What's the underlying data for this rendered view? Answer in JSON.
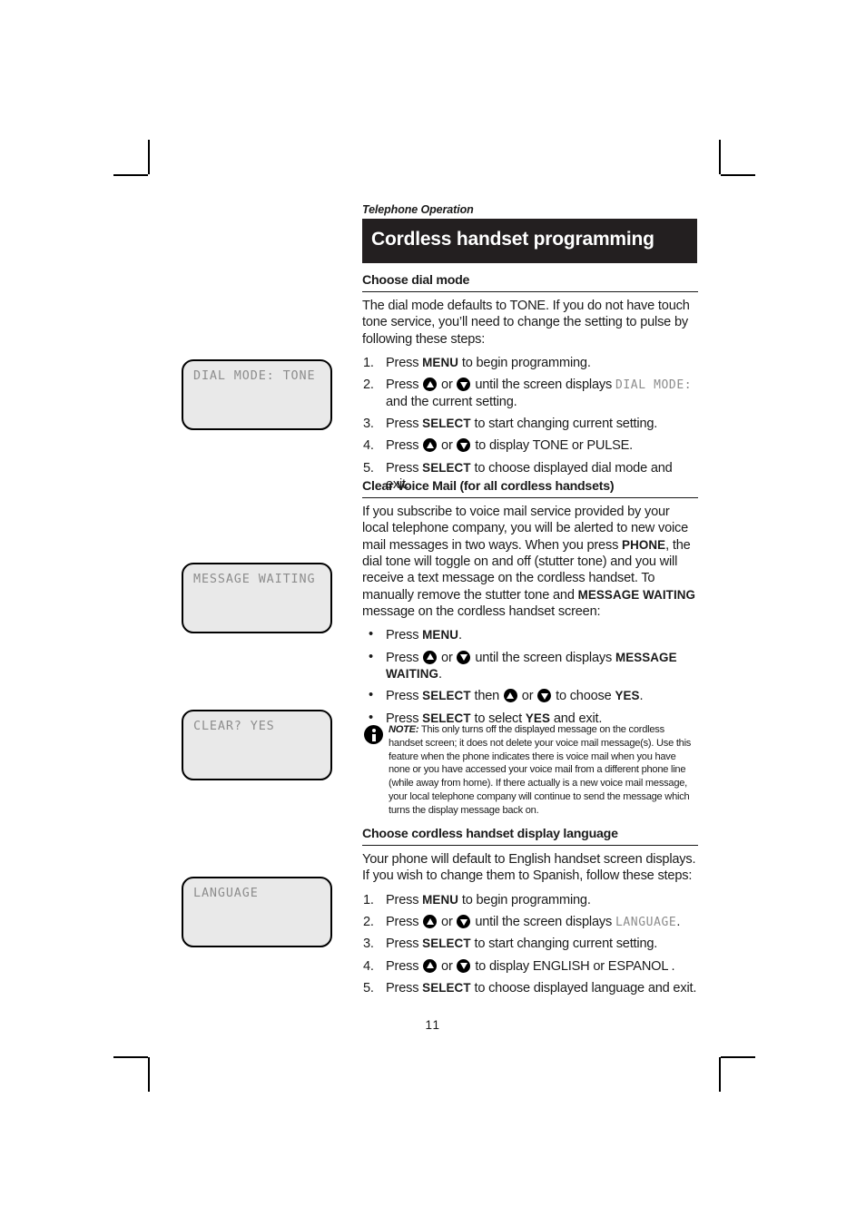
{
  "page": {
    "running_head": "Telephone Operation",
    "chapter_title": "Cordless handset programming",
    "folio": "11"
  },
  "sections": [
    {
      "id": "dial-mode",
      "heading": "Choose dial mode",
      "intro": "The dial mode defaults to TONE. If you do not have touch tone service, you’ll need to change the setting to pulse by following these steps:",
      "steps": [
        {
          "num": "1.",
          "parts": [
            {
              "t": "text",
              "v": "Press "
            },
            {
              "t": "bold",
              "v": "MENU"
            },
            {
              "t": "text",
              "v": " to begin programming."
            }
          ]
        },
        {
          "num": "2.",
          "parts": [
            {
              "t": "text",
              "v": "Press "
            },
            {
              "t": "icon",
              "v": "arrow-up-key-icon"
            },
            {
              "t": "text",
              "v": " or "
            },
            {
              "t": "icon",
              "v": "arrow-down-key-icon"
            },
            {
              "t": "text",
              "v": " until the screen displays "
            },
            {
              "t": "lcd",
              "v": "DIAL MODE:"
            },
            {
              "t": "text",
              "v": " and the current setting."
            }
          ]
        },
        {
          "num": "3.",
          "parts": [
            {
              "t": "text",
              "v": "Press "
            },
            {
              "t": "bold",
              "v": "SELECT"
            },
            {
              "t": "text",
              "v": " to start changing current setting."
            }
          ]
        },
        {
          "num": "4.",
          "parts": [
            {
              "t": "text",
              "v": "Press "
            },
            {
              "t": "icon",
              "v": "arrow-up-key-icon"
            },
            {
              "t": "text",
              "v": " or "
            },
            {
              "t": "icon",
              "v": "arrow-down-key-icon"
            },
            {
              "t": "text",
              "v": " to display TONE or PULSE."
            }
          ]
        },
        {
          "num": "5.",
          "parts": [
            {
              "t": "text",
              "v": "Press "
            },
            {
              "t": "bold",
              "v": "SELECT"
            },
            {
              "t": "text",
              "v": " to choose displayed dial mode and exit."
            }
          ]
        }
      ]
    },
    {
      "id": "clear-voice-mail",
      "heading": "Clear Voice Mail (for all cordless handsets)",
      "intro_parts": [
        {
          "t": "text",
          "v": "If you subscribe to voice mail service provided by your local telephone company, you will be alerted to new voice mail messages in two ways. When you press "
        },
        {
          "t": "bold",
          "v": "PHONE"
        },
        {
          "t": "text",
          "v": ", the dial tone will toggle on and off (stutter tone) and you will receive a text message on the cordless handset. To manually remove the stutter tone and "
        },
        {
          "t": "bold",
          "v": "MESSAGE WAITING"
        },
        {
          "t": "text",
          "v": " message on the cordless handset screen:"
        }
      ],
      "bullets": [
        {
          "dot": "•",
          "parts": [
            {
              "t": "text",
              "v": "Press "
            },
            {
              "t": "bold",
              "v": "MENU"
            },
            {
              "t": "text",
              "v": "."
            }
          ]
        },
        {
          "dot": "•",
          "parts": [
            {
              "t": "text",
              "v": "Press "
            },
            {
              "t": "icon",
              "v": "arrow-up-key-icon"
            },
            {
              "t": "text",
              "v": " or "
            },
            {
              "t": "icon",
              "v": "arrow-down-key-icon"
            },
            {
              "t": "text",
              "v": " until the screen displays "
            },
            {
              "t": "bold",
              "v": "MESSAGE WAITING"
            },
            {
              "t": "text",
              "v": "."
            }
          ]
        },
        {
          "dot": "•",
          "parts": [
            {
              "t": "text",
              "v": "Press "
            },
            {
              "t": "bold",
              "v": "SELECT"
            },
            {
              "t": "text",
              "v": " then "
            },
            {
              "t": "icon",
              "v": "arrow-up-key-icon"
            },
            {
              "t": "text",
              "v": " or "
            },
            {
              "t": "icon",
              "v": "arrow-down-key-icon"
            },
            {
              "t": "text",
              "v": " to choose "
            },
            {
              "t": "bold",
              "v": "YES"
            },
            {
              "t": "text",
              "v": "."
            }
          ]
        },
        {
          "dot": "•",
          "parts": [
            {
              "t": "text",
              "v": "Press "
            },
            {
              "t": "bold",
              "v": "SELECT"
            },
            {
              "t": "text",
              "v": " to select "
            },
            {
              "t": "bold",
              "v": "YES"
            },
            {
              "t": "text",
              "v": " and exit."
            }
          ]
        }
      ],
      "note": {
        "icon": "info-icon",
        "lead": "NOTE:",
        "body": " This only turns off the displayed message on the cordless handset screen; it does not delete your voice mail message(s). Use this feature when the phone indicates there is voice mail when you have none or you have accessed your voice mail from a different phone line (while away from home). If there actually is a new voice mail message, your local telephone company will continue to send the message which turns the display message back on."
      }
    },
    {
      "id": "display-language",
      "heading": "Choose cordless handset display language",
      "intro": "Your phone will default to English handset screen displays. If you wish to change them to Spanish, follow these steps:",
      "steps": [
        {
          "num": "1.",
          "parts": [
            {
              "t": "text",
              "v": "Press "
            },
            {
              "t": "bold",
              "v": "MENU"
            },
            {
              "t": "text",
              "v": " to begin programming."
            }
          ]
        },
        {
          "num": "2.",
          "parts": [
            {
              "t": "text",
              "v": "Press "
            },
            {
              "t": "icon",
              "v": "arrow-up-key-icon"
            },
            {
              "t": "text",
              "v": " or "
            },
            {
              "t": "icon",
              "v": "arrow-down-key-icon"
            },
            {
              "t": "text",
              "v": " until the screen displays "
            },
            {
              "t": "lcd",
              "v": "LANGUAGE"
            },
            {
              "t": "text",
              "v": "."
            }
          ]
        },
        {
          "num": "3.",
          "parts": [
            {
              "t": "text",
              "v": "Press "
            },
            {
              "t": "bold",
              "v": "SELECT"
            },
            {
              "t": "text",
              "v": " to start changing current setting."
            }
          ]
        },
        {
          "num": "4.",
          "parts": [
            {
              "t": "text",
              "v": "Press "
            },
            {
              "t": "icon",
              "v": "arrow-up-key-icon"
            },
            {
              "t": "text",
              "v": " or "
            },
            {
              "t": "icon",
              "v": "arrow-down-key-icon"
            },
            {
              "t": "text",
              "v": " to display ENGLISH or ESPANOL ."
            }
          ]
        },
        {
          "num": "5.",
          "parts": [
            {
              "t": "text",
              "v": "Press "
            },
            {
              "t": "bold",
              "v": "SELECT"
            },
            {
              "t": "text",
              "v": " to choose displayed language and exit."
            }
          ]
        }
      ]
    }
  ],
  "lcd_screens": [
    {
      "id": "lcd-dial-mode",
      "text": "DIAL MODE: TONE"
    },
    {
      "id": "lcd-message-waiting",
      "text": "MESSAGE WAITING"
    },
    {
      "id": "lcd-clear-yes",
      "text": "CLEAR? YES"
    },
    {
      "id": "lcd-language",
      "text": "LANGUAGE"
    }
  ],
  "colors": {
    "band": "#231f20",
    "lcd_fill": "#e9e9e9",
    "lcd_text": "#8d8d8d",
    "ink": "#1a1a1a"
  }
}
